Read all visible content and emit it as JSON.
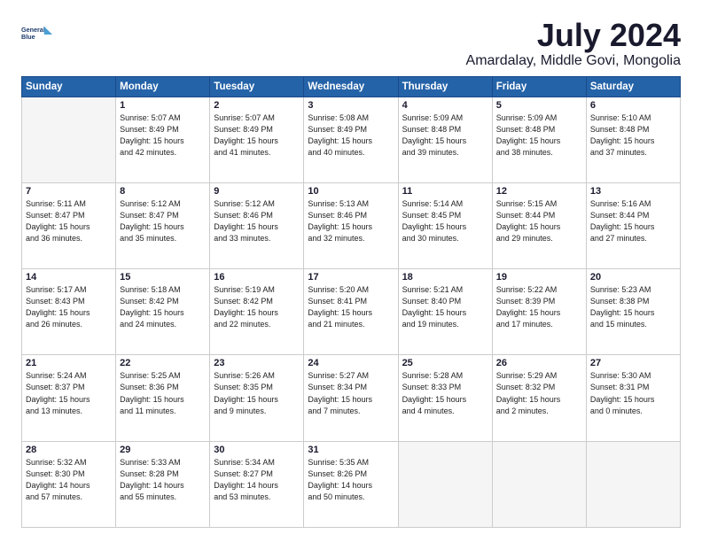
{
  "header": {
    "logo_line1": "General",
    "logo_line2": "Blue",
    "month": "July 2024",
    "location": "Amardalay, Middle Govi, Mongolia"
  },
  "days_of_week": [
    "Sunday",
    "Monday",
    "Tuesday",
    "Wednesday",
    "Thursday",
    "Friday",
    "Saturday"
  ],
  "weeks": [
    [
      {
        "day": "",
        "info": ""
      },
      {
        "day": "1",
        "info": "Sunrise: 5:07 AM\nSunset: 8:49 PM\nDaylight: 15 hours\nand 42 minutes."
      },
      {
        "day": "2",
        "info": "Sunrise: 5:07 AM\nSunset: 8:49 PM\nDaylight: 15 hours\nand 41 minutes."
      },
      {
        "day": "3",
        "info": "Sunrise: 5:08 AM\nSunset: 8:49 PM\nDaylight: 15 hours\nand 40 minutes."
      },
      {
        "day": "4",
        "info": "Sunrise: 5:09 AM\nSunset: 8:48 PM\nDaylight: 15 hours\nand 39 minutes."
      },
      {
        "day": "5",
        "info": "Sunrise: 5:09 AM\nSunset: 8:48 PM\nDaylight: 15 hours\nand 38 minutes."
      },
      {
        "day": "6",
        "info": "Sunrise: 5:10 AM\nSunset: 8:48 PM\nDaylight: 15 hours\nand 37 minutes."
      }
    ],
    [
      {
        "day": "7",
        "info": "Sunrise: 5:11 AM\nSunset: 8:47 PM\nDaylight: 15 hours\nand 36 minutes."
      },
      {
        "day": "8",
        "info": "Sunrise: 5:12 AM\nSunset: 8:47 PM\nDaylight: 15 hours\nand 35 minutes."
      },
      {
        "day": "9",
        "info": "Sunrise: 5:12 AM\nSunset: 8:46 PM\nDaylight: 15 hours\nand 33 minutes."
      },
      {
        "day": "10",
        "info": "Sunrise: 5:13 AM\nSunset: 8:46 PM\nDaylight: 15 hours\nand 32 minutes."
      },
      {
        "day": "11",
        "info": "Sunrise: 5:14 AM\nSunset: 8:45 PM\nDaylight: 15 hours\nand 30 minutes."
      },
      {
        "day": "12",
        "info": "Sunrise: 5:15 AM\nSunset: 8:44 PM\nDaylight: 15 hours\nand 29 minutes."
      },
      {
        "day": "13",
        "info": "Sunrise: 5:16 AM\nSunset: 8:44 PM\nDaylight: 15 hours\nand 27 minutes."
      }
    ],
    [
      {
        "day": "14",
        "info": "Sunrise: 5:17 AM\nSunset: 8:43 PM\nDaylight: 15 hours\nand 26 minutes."
      },
      {
        "day": "15",
        "info": "Sunrise: 5:18 AM\nSunset: 8:42 PM\nDaylight: 15 hours\nand 24 minutes."
      },
      {
        "day": "16",
        "info": "Sunrise: 5:19 AM\nSunset: 8:42 PM\nDaylight: 15 hours\nand 22 minutes."
      },
      {
        "day": "17",
        "info": "Sunrise: 5:20 AM\nSunset: 8:41 PM\nDaylight: 15 hours\nand 21 minutes."
      },
      {
        "day": "18",
        "info": "Sunrise: 5:21 AM\nSunset: 8:40 PM\nDaylight: 15 hours\nand 19 minutes."
      },
      {
        "day": "19",
        "info": "Sunrise: 5:22 AM\nSunset: 8:39 PM\nDaylight: 15 hours\nand 17 minutes."
      },
      {
        "day": "20",
        "info": "Sunrise: 5:23 AM\nSunset: 8:38 PM\nDaylight: 15 hours\nand 15 minutes."
      }
    ],
    [
      {
        "day": "21",
        "info": "Sunrise: 5:24 AM\nSunset: 8:37 PM\nDaylight: 15 hours\nand 13 minutes."
      },
      {
        "day": "22",
        "info": "Sunrise: 5:25 AM\nSunset: 8:36 PM\nDaylight: 15 hours\nand 11 minutes."
      },
      {
        "day": "23",
        "info": "Sunrise: 5:26 AM\nSunset: 8:35 PM\nDaylight: 15 hours\nand 9 minutes."
      },
      {
        "day": "24",
        "info": "Sunrise: 5:27 AM\nSunset: 8:34 PM\nDaylight: 15 hours\nand 7 minutes."
      },
      {
        "day": "25",
        "info": "Sunrise: 5:28 AM\nSunset: 8:33 PM\nDaylight: 15 hours\nand 4 minutes."
      },
      {
        "day": "26",
        "info": "Sunrise: 5:29 AM\nSunset: 8:32 PM\nDaylight: 15 hours\nand 2 minutes."
      },
      {
        "day": "27",
        "info": "Sunrise: 5:30 AM\nSunset: 8:31 PM\nDaylight: 15 hours\nand 0 minutes."
      }
    ],
    [
      {
        "day": "28",
        "info": "Sunrise: 5:32 AM\nSunset: 8:30 PM\nDaylight: 14 hours\nand 57 minutes."
      },
      {
        "day": "29",
        "info": "Sunrise: 5:33 AM\nSunset: 8:28 PM\nDaylight: 14 hours\nand 55 minutes."
      },
      {
        "day": "30",
        "info": "Sunrise: 5:34 AM\nSunset: 8:27 PM\nDaylight: 14 hours\nand 53 minutes."
      },
      {
        "day": "31",
        "info": "Sunrise: 5:35 AM\nSunset: 8:26 PM\nDaylight: 14 hours\nand 50 minutes."
      },
      {
        "day": "",
        "info": ""
      },
      {
        "day": "",
        "info": ""
      },
      {
        "day": "",
        "info": ""
      }
    ]
  ]
}
